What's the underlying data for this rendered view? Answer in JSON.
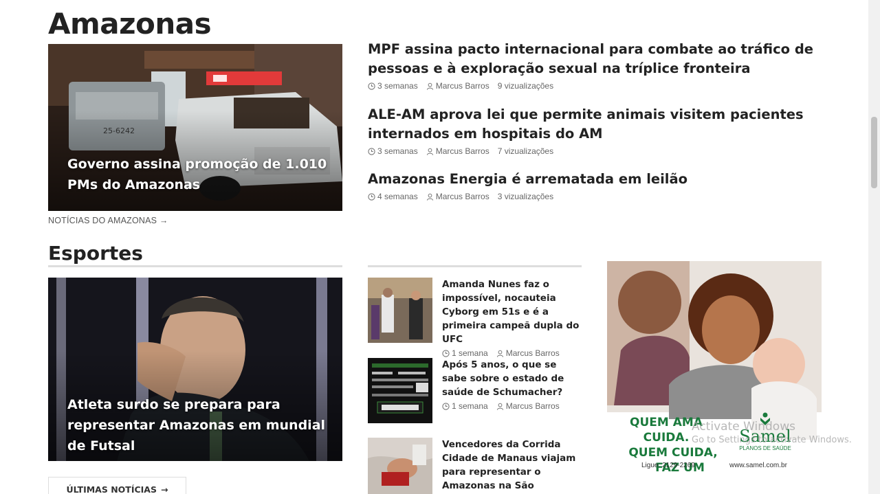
{
  "amazonas": {
    "title": "Amazonas",
    "hero_caption": "Governo assina promoção de 1.010 PMs do Amazonas",
    "more_link": "NOTÍCIAS DO AMAZONAS",
    "more_arrow": "→",
    "headlines": [
      {
        "title": "MPF assina pacto internacional para combate ao tráfico de pessoas e à exploração sexual na tríplice fronteira",
        "time": "3 semanas",
        "author": "Marcus Barros",
        "views": "9 vizualizações"
      },
      {
        "title": "ALE-AM aprova lei que permite animais visitem pacientes internados em hospitais do AM",
        "time": "3 semanas",
        "author": "Marcus Barros",
        "views": "7 vizualizações"
      },
      {
        "title": "Amazonas Energia é arrematada em leilão",
        "time": "4 semanas",
        "author": "Marcus Barros",
        "views": "3 vizualizações"
      }
    ]
  },
  "esportes": {
    "title": "Esportes",
    "hero_caption": "Atleta surdo se prepara para representar Amazonas em mundial de Futsal",
    "items": [
      {
        "title": "Amanda Nunes faz o impossível, nocauteia Cyborg em 51s e é a primeira campeã dupla do UFC",
        "time": "1 semana",
        "author": "Marcus Barros"
      },
      {
        "title": "Após 5 anos, o que se sabe sobre o estado de saúde de Schumacher?",
        "time": "1 semana",
        "author": "Marcus Barros"
      },
      {
        "title": "Vencedores da Corrida Cidade de Manaus viajam para representar o Amazonas na São Silvestre",
        "time": "",
        "author": ""
      }
    ],
    "button_label": "ÚLTIMAS NOTÍCIAS",
    "button_arrow": "→"
  },
  "ad": {
    "slogan_line1": "QUEM AMA CUIDA.",
    "slogan_line2": "QUEM CUIDA,",
    "slogan_line3": "FAZ UM PLANO.",
    "brand": "Samel",
    "brand_sub": "PLANOS DE SAÚDE",
    "phone": "Ligue: 2129-2269",
    "url": "www.samel.com.br"
  },
  "watermark": {
    "line1": "Activate Windows",
    "line2": "Go to Settings to activate Windows."
  },
  "colors": {
    "accent_green": "#1a7a3c",
    "text_dark": "#222222",
    "meta_gray": "#666666"
  }
}
